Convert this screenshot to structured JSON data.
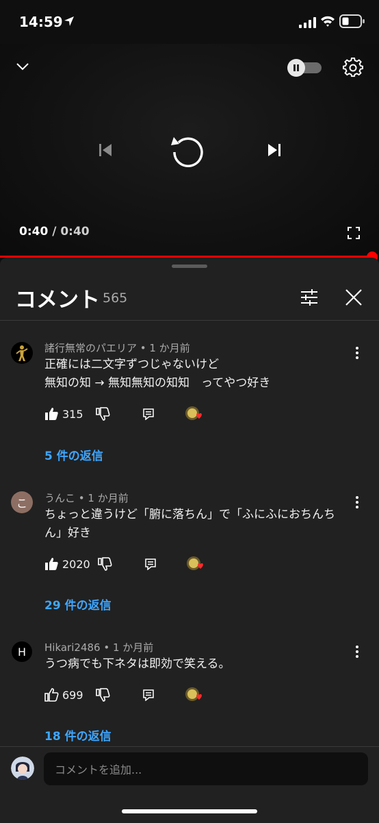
{
  "status": {
    "time": "14:59"
  },
  "player": {
    "current": "0:40",
    "separator": " / ",
    "duration": "0:40",
    "progress_fraction": 1.0,
    "autoplay_on": false
  },
  "panel": {
    "title": "コメント",
    "count": "565",
    "input_placeholder": "コメントを追加..."
  },
  "comments": [
    {
      "author": "諸行無常のパエリア",
      "age": "1 か月前",
      "line1": "正確には二文字ずつじゃないけど",
      "line2": "無知の知 → 無知無知の知知　ってやつ好き",
      "likes": "315",
      "replies": "5 件の返信",
      "liked": true
    },
    {
      "author": "うんこ",
      "age": "1 か月前",
      "avatar_letter": "こ",
      "avatar_color": "#8d6e63",
      "line1": "ちょっと違うけど「腑に落ちん」で「ふにふにおちんち",
      "line2": "ん」好き",
      "likes": "2020",
      "replies": "29 件の返信",
      "liked": true
    },
    {
      "author": "Hikari2486",
      "age": "1 か月前",
      "avatar_letter": "H",
      "avatar_color": "#000000",
      "line1": "うつ病でも下ネタは即効で笑える。",
      "likes": "699",
      "replies": "18 件の返信",
      "liked": false
    }
  ],
  "colors": {
    "accent_red": "#ff0000",
    "reply_link": "#3ea6ff",
    "panel_bg": "#212121"
  }
}
